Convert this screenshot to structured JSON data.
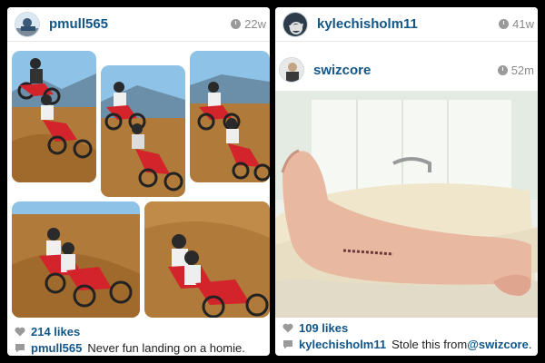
{
  "left_post": {
    "username": "pmull565",
    "time": "22w",
    "likes": "214 likes",
    "caption_user": "pmull565",
    "caption_text": "Never fun landing on a homie."
  },
  "right_post": {
    "username": "kylechisholm11",
    "time": "41w",
    "repost_username": "swizcore",
    "repost_time": "52m",
    "likes": "109 likes",
    "caption_user": "kylechisholm11",
    "caption_text": "Stole this from ",
    "caption_mention": "@swizcore",
    "caption_end": " ."
  },
  "colors": {
    "link": "#125688",
    "dirt": "#b07a3a",
    "sky": "#7fb3d9",
    "bike_red": "#d3242c"
  },
  "icons": [
    "clock-icon",
    "heart-icon",
    "comment-bubble-icon"
  ]
}
